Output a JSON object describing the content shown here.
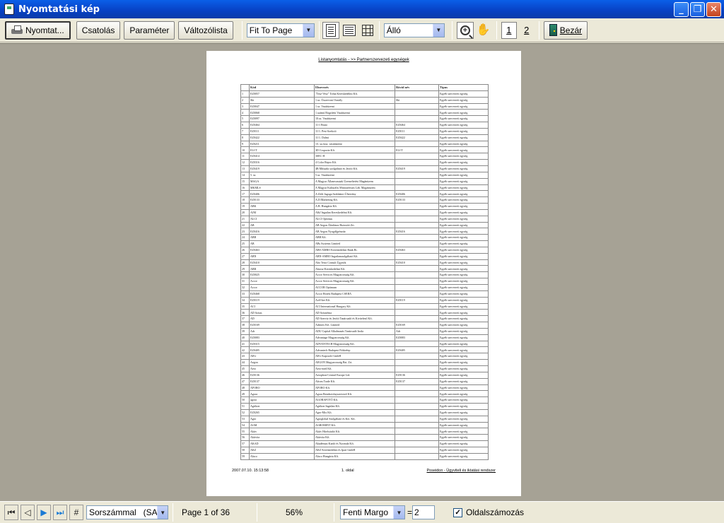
{
  "window": {
    "title": "Nyomtatási kép",
    "minimize": "_",
    "maximize": "❐",
    "close": "✕"
  },
  "toolbar": {
    "print_label": "Nyomtat...",
    "attach_label": "Csatolás",
    "param_label": "Paraméter",
    "varlist_label": "Változólista",
    "fit_value": "Fit To Page",
    "orientation_value": "Álló",
    "page1_label": "1",
    "page2_label": "2",
    "close_label": "Bezár"
  },
  "report": {
    "title": "Listanyomtatás - >> Partnerszervezeti egységek",
    "columns": [
      "Kód",
      "Elnevezés",
      "Rövid név",
      "Típus"
    ],
    "rows": [
      [
        "1",
        "EZ0057",
        "\"Tesz-Vesz\" Tolna Kereskedelmi Kft.",
        "",
        "Egyéb szervezeti egység"
      ],
      [
        "2",
        "Ski",
        "1.sz. Összevont Osztály",
        "Ski",
        "Egyéb szervezeti egység"
      ],
      [
        "3",
        "EZ0047",
        "1.sz. Vasútüzemi",
        "",
        "Egyéb szervezeti egység"
      ],
      [
        "4",
        "EZ0068",
        "1.számú Rögzítési Vasútüzemi",
        "",
        "Egyéb szervezeti egység"
      ],
      [
        "5",
        "EZ0097",
        "10.sz. Vasútüzemi",
        "",
        "Egyéb szervezeti egység"
      ],
      [
        "6",
        "EZ0464",
        "11/1 Bruto",
        "EZ0464",
        "Egyéb szervezeti egység"
      ],
      [
        "7",
        "EZ0111",
        "11/1. Pest-Szekció",
        "EZ0111",
        "Egyéb szervezeti egység"
      ],
      [
        "8",
        "EZ0422",
        "11/1. Dalmi",
        "EZ0422",
        "Egyéb szervezeti egység"
      ],
      [
        "9",
        "EZ0211",
        "1/l. sz.össz. vasútüzemi",
        "",
        "Egyéb szervezeti egység"
      ],
      [
        "10",
        "ELCT",
        "3D Cosporin Kft.",
        "ELCT",
        "Egyéb szervezeti egység"
      ],
      [
        "11",
        "EZ0414",
        "3SEC H",
        "",
        "Egyéb szervezeti egység"
      ],
      [
        "12",
        "EZ0316",
        "4 Color Repro Kft.",
        "",
        "Egyéb szervezeti egység"
      ],
      [
        "13",
        "EZ0419",
        "4B Műszaki szolgáltató és Javító Kft.",
        "EZ0419",
        "Egyéb szervezeti egység"
      ],
      [
        "14",
        "5. sz.",
        "5.sz. Vasútüzemi",
        "",
        "Egyéb szervezeti egység"
      ],
      [
        "15",
        "MAGA",
        "A Magyar Államvasutak Üzemeltetési Magánüzem",
        "",
        "Egyéb szervezeti egység"
      ],
      [
        "16",
        "MKMLS",
        "A Magyar Kulturális Minisztérium Láb. Magánüzem",
        "",
        "Egyéb szervezeti egység"
      ],
      [
        "17",
        "EZ0406",
        "A Zöld Jugoga Sziklakert Ültetvény",
        "EZ0406",
        "Egyéb szervezeti egység"
      ],
      [
        "18",
        "EZ0133",
        "A.D.Marketing Kft.",
        "EZ0133",
        "Egyéb szervezeti egység"
      ],
      [
        "19",
        "ABK",
        "A.B. Hungária Kft.",
        "",
        "Egyéb szervezeti egység"
      ],
      [
        "20",
        "AJM",
        "A&J Ingatlan Kereskedelmi Kft.",
        "",
        "Egyéb szervezeti egység"
      ],
      [
        "21",
        "ALCI",
        "ALCI Optimus",
        "",
        "Egyéb szervezeti egység"
      ],
      [
        "22",
        "AB",
        "AB Aegon Általános Biztosító Zrt.",
        "",
        "Egyéb szervezeti egység"
      ],
      [
        "23",
        "EZ0416",
        "AB Aegon Nyugdíjpénztár",
        "EZ0416",
        "Egyéb szervezeti egység"
      ],
      [
        "24",
        "ABB",
        "ABB Kft.",
        "",
        "Egyéb szervezeti egység"
      ],
      [
        "25",
        "AB",
        "ABs Systems Limited",
        "",
        "Egyéb szervezeti egység"
      ],
      [
        "26",
        "EZ0463",
        "ABS-AMRO Kereskedelmi Bank Rt.",
        "EZ0463",
        "Egyéb szervezeti egység"
      ],
      [
        "27",
        "ABN",
        "ABN-AMRO Ingatlanszolgáltató Kft.",
        "",
        "Egyéb szervezeti egység"
      ],
      [
        "28",
        "EZ0410",
        "Abo Terra Consult Ügynök",
        "EZ0410",
        "Egyéb szervezeti egység"
      ],
      [
        "29",
        "ABR",
        "Abrosz-Kereskedelmi Kft.",
        "",
        "Egyéb szervezeti egység"
      ],
      [
        "30",
        "EZ0025",
        "Accor Services Magyarország Kft.",
        "",
        "Egyéb szervezeti egység"
      ],
      [
        "31",
        "Accor",
        "Accor Services Magyarország Kft.",
        "",
        "Egyéb szervezeti egység"
      ],
      [
        "32",
        "Accor",
        "ACCOR Optimum",
        "",
        "Egyéb szervezeti egység"
      ],
      [
        "33",
        "EZ0468",
        "Accor Hotels Budapest CSEBA",
        "",
        "Egyéb szervezeti egység"
      ],
      [
        "34",
        "EZ0119",
        "Acél-ker Kft.",
        "EZ0119",
        "Egyéb szervezeti egység"
      ],
      [
        "35",
        "ACI",
        "ACI International Hungary Kft.",
        "",
        "Egyéb szervezeti egység"
      ],
      [
        "36",
        "AD Sziszt.",
        "AD Szisztéma",
        "",
        "Egyéb szervezeti egység"
      ],
      [
        "37",
        "AD",
        "AD Szerviz és Javító Tanácsadó és Kivitelező Kft.",
        "",
        "Egyéb szervezeti egység"
      ],
      [
        "38",
        "EZ0169",
        "Adrinex Kft. Limited",
        "EZ0169",
        "Egyéb szervezeti egység"
      ],
      [
        "39",
        "Adr",
        "ADU Capital Alkalmazás Tanácsadó Iroda",
        "Adr",
        "Egyéb szervezeti egység"
      ],
      [
        "40",
        "EZ0083",
        "Advantage Magyarország Kft.",
        "EZ0083",
        "Egyéb szervezeti egység"
      ],
      [
        "41",
        "EZ0315",
        "ADVANTECH Magyarország Kft.",
        "",
        "Egyéb szervezeti egység"
      ],
      [
        "42",
        "EZ0405",
        "Advantech Budapest Fióktelep",
        "EZ0405",
        "Egyéb szervezeti egység"
      ],
      [
        "43",
        "AEG",
        "AEG Kapcsoló GmbH",
        "",
        "Egyéb szervezeti egység"
      ],
      [
        "44",
        "Aegon",
        "AEGON Magyarország Bzt. Zrt.",
        "",
        "Egyéb szervezeti egység"
      ],
      [
        "45",
        "Aero",
        "Aero-med Kft.",
        "",
        "Egyéb szervezeti egység"
      ],
      [
        "46",
        "EZ0136",
        "Aerophon-Central Europe Ltd.",
        "EZ0136",
        "Egyéb szervezeti egység"
      ],
      [
        "47",
        "EZ0137",
        "Afrom Trade Kft.",
        "EZ0137",
        "Egyéb szervezeti egység"
      ],
      [
        "48",
        "AFORO",
        "AFORO Kft.",
        "",
        "Egyéb szervezeti egység"
      ],
      [
        "49",
        "Agora",
        "Agora Rendezvényszervező Kft.",
        "",
        "Egyéb szervezeti egység"
      ],
      [
        "50",
        "agora",
        "AGORAFOTÓ Kft.",
        "",
        "Egyéb szervezeti egység"
      ],
      [
        "51",
        "Agrikon",
        "Agrikon Ingatlan Kft.",
        "",
        "Egyéb szervezeti egység"
      ],
      [
        "52",
        "EZ0265",
        "Agro-Mix Kft.",
        "",
        "Egyéb szervezeti egység"
      ],
      [
        "53",
        "Agro",
        "Agroglobal Szolgáltató és Ker. Kft.",
        "",
        "Egyéb szervezeti egység"
      ],
      [
        "54",
        "AGM",
        "AGROMINT Kft.",
        "",
        "Egyéb szervezeti egység"
      ],
      [
        "55",
        "Aktiv",
        "Aktív Hitelstúdió Kft.",
        "",
        "Egyéb szervezeti egység"
      ],
      [
        "56",
        "Aktivita",
        "Aktivita Kft.",
        "",
        "Egyéb szervezeti egység"
      ],
      [
        "57",
        "AKAD",
        "Akadémiai Kiadó és Nyomda Kft.",
        "",
        "Egyéb szervezeti egység"
      ],
      [
        "58",
        "AKZ",
        "AKZ Kereskedelmi és Ipari GmbH",
        "",
        "Egyéb szervezeti egység"
      ],
      [
        "59",
        "Aluco",
        "Aluco Hungária Kft.",
        "",
        "Egyéb szervezeti egység"
      ]
    ],
    "footer_date": "2007.07.10. 15:13:58",
    "footer_page": "1. oldal",
    "footer_app": "Poseidon - Ügyviteli és iktatási rendszer"
  },
  "status": {
    "sort_value": "Sorszámmal   (SAM",
    "page_info": "Page 1 of 36",
    "zoom": "56%",
    "margin_value": "Fenti Margo",
    "equals": "=",
    "margin_number": "2",
    "page_numbering_label": "Oldalszámozás",
    "page_numbering_checked": "✓"
  }
}
